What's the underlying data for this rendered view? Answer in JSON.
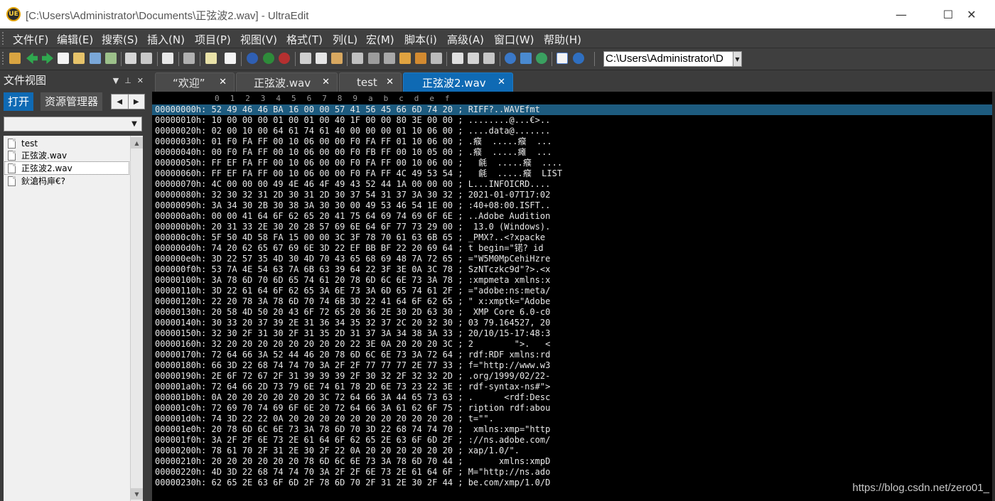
{
  "window": {
    "logo_text": "UE",
    "title": "[C:\\Users\\Administrator\\Documents\\正弦波2.wav] - UltraEdit",
    "minimize_glyph": "—",
    "maximize_glyph": "☐",
    "close_glyph": "✕"
  },
  "menu": [
    "文件(F)",
    "编辑(E)",
    "搜索(S)",
    "插入(N)",
    "项目(P)",
    "视图(V)",
    "格式(T)",
    "列(L)",
    "宏(M)",
    "脚本(i)",
    "高级(A)",
    "窗口(W)",
    "帮助(H)"
  ],
  "toolbar": {
    "path_value": "C:\\Users\\Administrator\\D",
    "dropdown_glyph": "▼"
  },
  "file_view": {
    "title": "文件视图",
    "tabs": [
      "打开",
      "资源管理器"
    ],
    "files": [
      "test",
      "正弦波.wav",
      "正弦波2.wav",
      "鈥滄杩庘€?"
    ],
    "selected_index": 2
  },
  "editor_tabs": [
    {
      "label": "“欢迎”",
      "active": false
    },
    {
      "label": "正弦波.wav",
      "active": false
    },
    {
      "label": "test",
      "active": false
    },
    {
      "label": "正弦波2.wav",
      "active": true
    }
  ],
  "hex": {
    "ruler": [
      "0",
      "1",
      "2",
      "3",
      "4",
      "5",
      "6",
      "7",
      "8",
      "9",
      "a",
      "b",
      "c",
      "d",
      "e",
      "f"
    ],
    "current_row": 0,
    "rows": [
      "00000000h: 52 49 46 46 BA 16 00 00 57 41 56 45 66 6D 74 20 ; RIFF?..WAVEfmt ",
      "00000010h: 10 00 00 00 01 00 01 00 40 1F 00 00 80 3E 00 00 ; ........@...€>..",
      "00000020h: 02 00 10 00 64 61 74 61 40 00 00 00 01 10 06 00 ; ....data@.......",
      "00000030h: 01 F0 FA FF 00 10 06 00 00 F0 FA FF 01 10 06 00 ; .瘊  .....瘊  ...",
      "00000040h: 00 F0 FA FF 00 10 06 00 00 F0 FB FF 00 10 05 00 ; .瘊  .....瘫  ...",
      "00000050h: FF EF FA FF 00 10 06 00 00 F0 FA FF 00 10 06 00 ;   毹  .....瘊  ....",
      "00000060h: FF EF FA FF 00 10 06 00 00 F0 FA FF 4C 49 53 54 ;   毹  .....瘊  LIST",
      "00000070h: 4C 00 00 00 49 4E 46 4F 49 43 52 44 1A 00 00 00 ; L...INFOICRD....",
      "00000080h: 32 30 32 31 2D 30 31 2D 30 37 54 31 37 3A 30 32 ; 2021-01-07T17:02",
      "00000090h: 3A 34 30 2B 30 38 3A 30 30 00 49 53 46 54 1E 00 ; :40+08:00.ISFT..",
      "000000a0h: 00 00 41 64 6F 62 65 20 41 75 64 69 74 69 6F 6E ; ..Adobe Audition",
      "000000b0h: 20 31 33 2E 30 20 28 57 69 6E 64 6F 77 73 29 00 ;  13.0 (Windows).",
      "000000c0h: 5F 50 4D 58 FA 15 00 00 3C 3F 78 70 61 63 6B 65 ; _PMX?..<?xpacke",
      "000000d0h: 74 20 62 65 67 69 6E 3D 22 EF BB BF 22 20 69 64 ; t begin=\"锘? id",
      "000000e0h: 3D 22 57 35 4D 30 4D 70 43 65 68 69 48 7A 72 65 ; =\"W5M0MpCehiHzre",
      "000000f0h: 53 7A 4E 54 63 7A 6B 63 39 64 22 3F 3E 0A 3C 78 ; SzNTczkc9d\"?>.<x",
      "00000100h: 3A 78 6D 70 6D 65 74 61 20 78 6D 6C 6E 73 3A 78 ; :xmpmeta xmlns:x",
      "00000110h: 3D 22 61 64 6F 62 65 3A 6E 73 3A 6D 65 74 61 2F ; =\"adobe:ns:meta/",
      "00000120h: 22 20 78 3A 78 6D 70 74 6B 3D 22 41 64 6F 62 65 ; \" x:xmptk=\"Adobe",
      "00000130h: 20 58 4D 50 20 43 6F 72 65 20 36 2E 30 2D 63 30 ;  XMP Core 6.0-c0",
      "00000140h: 30 33 20 37 39 2E 31 36 34 35 32 37 2C 20 32 30 ; 03 79.164527, 20",
      "00000150h: 32 30 2F 31 30 2F 31 35 2D 31 37 3A 34 38 3A 33 ; 20/10/15-17:48:3",
      "00000160h: 32 20 20 20 20 20 20 20 20 22 3E 0A 20 20 20 3C ; 2        \">.   <",
      "00000170h: 72 64 66 3A 52 44 46 20 78 6D 6C 6E 73 3A 72 64 ; rdf:RDF xmlns:rd",
      "00000180h: 66 3D 22 68 74 74 70 3A 2F 2F 77 77 77 2E 77 33 ; f=\"http://www.w3",
      "00000190h: 2E 6F 72 67 2F 31 39 39 39 2F 30 32 2F 32 32 2D ; .org/1999/02/22-",
      "000001a0h: 72 64 66 2D 73 79 6E 74 61 78 2D 6E 73 23 22 3E ; rdf-syntax-ns#\">",
      "000001b0h: 0A 20 20 20 20 20 20 3C 72 64 66 3A 44 65 73 63 ; .      <rdf:Desc",
      "000001c0h: 72 69 70 74 69 6F 6E 20 72 64 66 3A 61 62 6F 75 ; ription rdf:abou",
      "000001d0h: 74 3D 22 22 0A 20 20 20 20 20 20 20 20 20 20 20 ; t=\"\".           ",
      "000001e0h: 20 78 6D 6C 6E 73 3A 78 6D 70 3D 22 68 74 74 70 ;  xmlns:xmp=\"http",
      "000001f0h: 3A 2F 2F 6E 73 2E 61 64 6F 62 65 2E 63 6F 6D 2F ; ://ns.adobe.com/",
      "00000200h: 78 61 70 2F 31 2E 30 2F 22 0A 20 20 20 20 20 20 ; xap/1.0/\".      ",
      "00000210h: 20 20 20 20 20 20 78 6D 6C 6E 73 3A 78 6D 70 44 ;       xmlns:xmpD",
      "00000220h: 4D 3D 22 68 74 74 70 3A 2F 2F 6E 73 2E 61 64 6F ; M=\"http://ns.ado",
      "00000230h: 62 65 2E 63 6F 6D 2F 78 6D 70 2F 31 2E 30 2F 44 ; be.com/xmp/1.0/D"
    ]
  },
  "watermark": "https://blog.csdn.net/zero01_"
}
